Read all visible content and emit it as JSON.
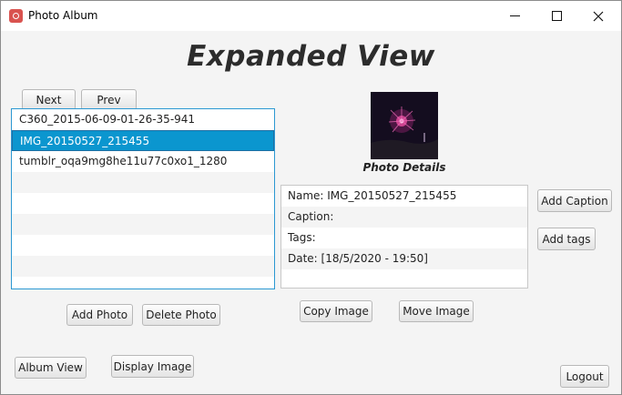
{
  "window": {
    "title": "Photo Album"
  },
  "heading": "Expanded View",
  "nav": {
    "next": "Next",
    "prev": "Prev"
  },
  "photos": {
    "items": [
      "C360_2015-06-09-01-26-35-941",
      "IMG_20150527_215455",
      "tumblr_oqa9mg8he11u77c0xo1_1280"
    ],
    "selected_index": 1
  },
  "details": {
    "title": "Photo Details",
    "name_label": "Name: IMG_20150527_215455",
    "caption_label": "Caption:",
    "tags_label": "Tags:",
    "date_label": "Date:  [18/5/2020 - 19:50]"
  },
  "buttons": {
    "add_caption": "Add Caption",
    "add_tags": "Add tags",
    "add_photo": "Add Photo",
    "delete_photo": "Delete Photo",
    "copy_image": "Copy Image",
    "move_image": "Move Image",
    "album_view": "Album View",
    "display_image": "Display Image",
    "logout": "Logout"
  },
  "colors": {
    "selection": "#0b96cf",
    "focus_border": "#2b98d2"
  }
}
